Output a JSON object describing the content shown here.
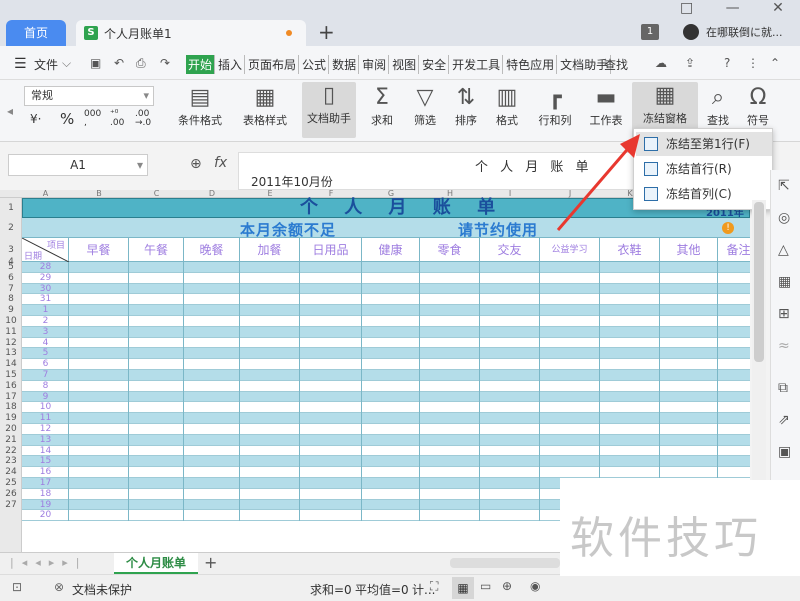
{
  "tabs": {
    "home": "首页",
    "document": "个人月账单1",
    "document_icon": "S",
    "new_tab": "+"
  },
  "window": {
    "badge": "1",
    "search_hint": "在哪联倒に就..."
  },
  "menu": {
    "file": "文件",
    "items": [
      "开始",
      "插入",
      "页面布局",
      "公式",
      "数据",
      "审阅",
      "视图",
      "安全",
      "开发工具",
      "特色应用",
      "文档助手"
    ],
    "active": "开始",
    "search": "查找"
  },
  "ribbon": {
    "number_format": "常规",
    "buttons": [
      "条件格式",
      "表格样式",
      "文档助手",
      "求和",
      "筛选",
      "排序",
      "格式",
      "行和列",
      "工作表",
      "冻结窗格",
      "查找",
      "符号"
    ]
  },
  "formula": {
    "name_box": "A1",
    "fx": "fx",
    "content": "个 人 月 账 单",
    "extra": "2011年10月份"
  },
  "freeze_menu": {
    "items": [
      "冻结至第1行(F)",
      "冻结首行(R)",
      "冻结首列(C)"
    ]
  },
  "sheet": {
    "title": "个 人 月 账 单",
    "date_right": "2011年1",
    "note_left": "本月余额不足",
    "note_right": "请节约使用",
    "header_corner_top": "项目",
    "header_corner_bottom": "日期",
    "columns": [
      "早餐",
      "午餐",
      "晚餐",
      "加餐",
      "日用品",
      "健康",
      "零食",
      "交友",
      "公益学习",
      "衣鞋",
      "其他",
      "备注"
    ],
    "col_letters": [
      "A",
      "B",
      "C",
      "D",
      "E",
      "F",
      "G",
      "H",
      "I",
      "J",
      "K",
      "L"
    ],
    "row_numbers": [
      "1",
      "2",
      "3",
      "4",
      "5",
      "6",
      "7",
      "8",
      "9",
      "10",
      "11",
      "12",
      "13",
      "14",
      "15",
      "16",
      "17",
      "18",
      "19",
      "20",
      "21",
      "22",
      "23",
      "24",
      "25",
      "26",
      "27"
    ],
    "days": [
      "28",
      "29",
      "30",
      "31",
      "1",
      "2",
      "3",
      "4",
      "5",
      "6",
      "7",
      "8",
      "9",
      "10",
      "11",
      "12",
      "13",
      "14",
      "15",
      "16",
      "17",
      "18",
      "19",
      "20"
    ]
  },
  "sheet_tab": {
    "name": "个人月账单",
    "add": "+"
  },
  "status": {
    "protect": "文档未保护",
    "sum": "求和=0",
    "avg": "平均值=0",
    "count": "计..."
  },
  "watermark": "软件技巧",
  "colors": {
    "accent": "#4a8bf0",
    "title_band": "#4fb3c6",
    "stripe": "#b4dde9",
    "title_text": "#1a4f9c"
  }
}
